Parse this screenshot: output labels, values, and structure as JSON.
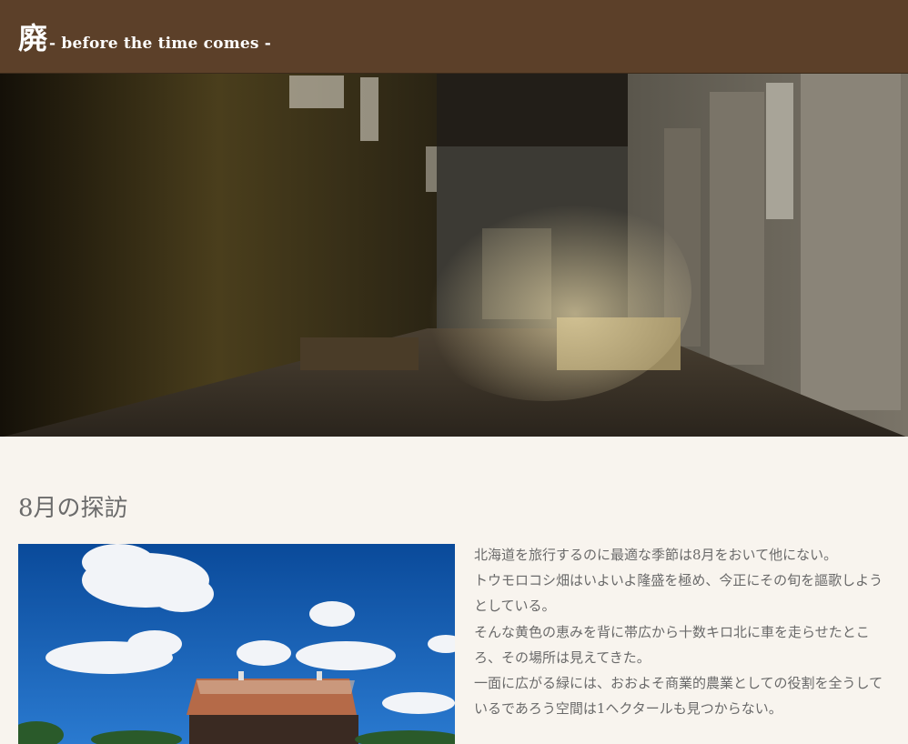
{
  "header": {
    "title_main": "廃",
    "title_sub": "- before the time comes -",
    "background": "#5c4029"
  },
  "hero": {
    "image_desc_icon": "abandoned-factory-hero-image"
  },
  "section": {
    "title": "8月の探訪",
    "paragraphs": [
      "北海道を旅行するのに最適な季節は8月をおいて他にない。",
      "トウモロコシ畑はいよいよ隆盛を極め、今正にその旬を謳歌しようとしている。",
      "そんな黄色の恵みを背に帯広から十数キロ北に車を走らせたところ、その場所は見えてきた。",
      "一面に広がる緑には、おおよそ商業的農業としての役割を全うしているであろう空間は1ヘクタールも見つからない。"
    ]
  },
  "colors": {
    "page_bg": "#f8f4ee",
    "text": "#6a6a6a"
  }
}
